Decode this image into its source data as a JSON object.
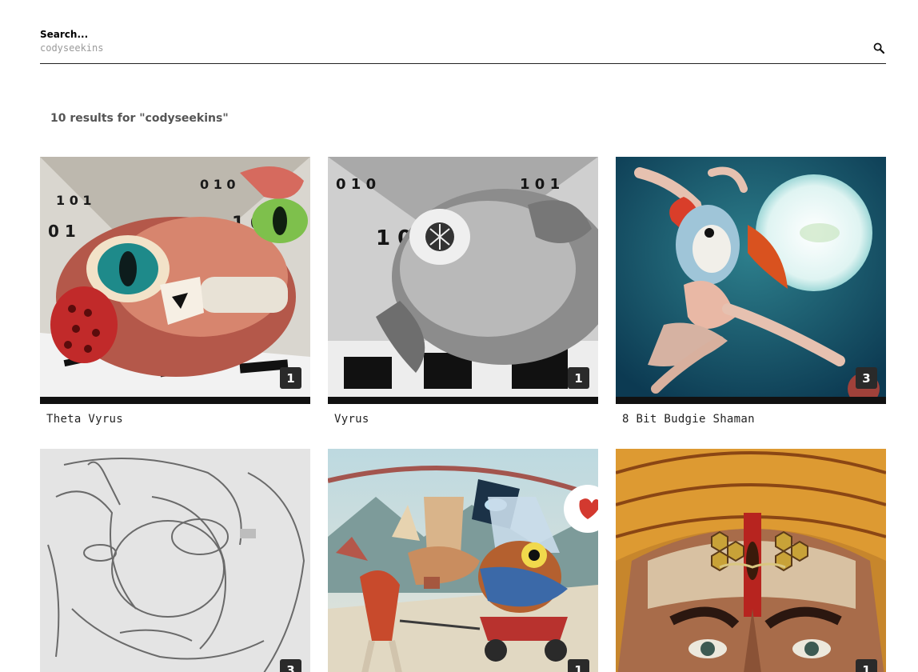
{
  "search": {
    "label": "Search...",
    "placeholder": "codyseekins",
    "icon": "search-icon"
  },
  "results": {
    "summary": "10 results for \"codyseekins\""
  },
  "artworks": [
    {
      "title": "Theta Vyrus",
      "count": "1"
    },
    {
      "title": "Vyrus",
      "count": "1"
    },
    {
      "title": "8 Bit Budgie Shaman",
      "count": "3"
    },
    {
      "title": "",
      "count": "3"
    },
    {
      "title": "",
      "count": "1"
    },
    {
      "title": "",
      "count": "1"
    }
  ]
}
